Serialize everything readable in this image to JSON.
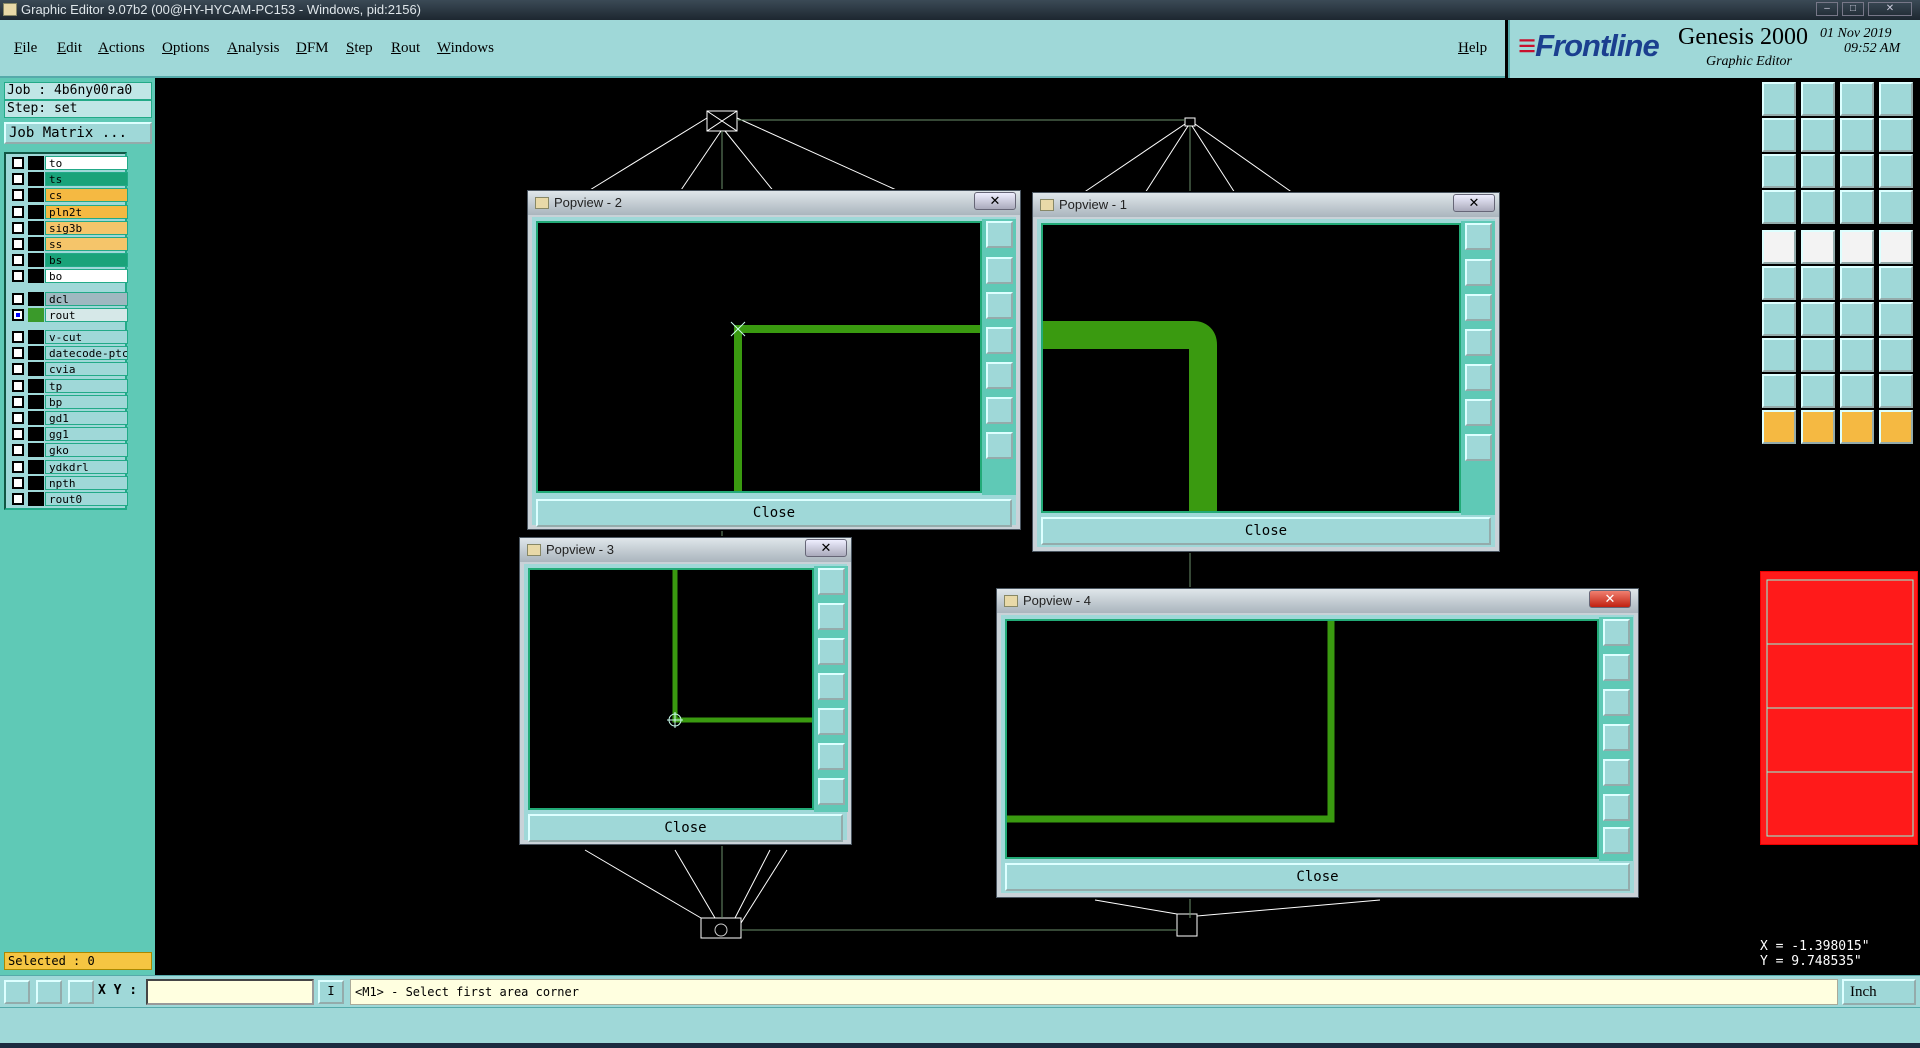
{
  "window": {
    "title": "Graphic Editor 9.07b2 (00@HY-HYCAM-PC153 - Windows, pid:2156)",
    "controls": [
      "–",
      "□",
      "✕"
    ]
  },
  "menu": {
    "items": [
      "File",
      "Edit",
      "Actions",
      "Options",
      "Analysis",
      "DFM",
      "Step",
      "Rout",
      "Windows"
    ],
    "help": "Help"
  },
  "brand": {
    "logo": "Frontline",
    "product": "Genesis 2000",
    "subtitle": "Graphic Editor",
    "date": "01 Nov 2019",
    "time": "09:52 AM"
  },
  "job": {
    "job_line": "Job : 4b6ny00ra0",
    "step_line": "Step: set",
    "matrix_button": "Job Matrix ..."
  },
  "layers": [
    {
      "name": "to",
      "color": "#ffffff",
      "group": 1
    },
    {
      "name": "ts",
      "color": "#1aa37a",
      "group": 1
    },
    {
      "name": "cs",
      "color": "#f5b942",
      "group": 1
    },
    {
      "name": "pln2t",
      "color": "#f5b942",
      "group": 1
    },
    {
      "name": "sig3b",
      "color": "#f5c56a",
      "group": 1
    },
    {
      "name": "ss",
      "color": "#f5c56a",
      "group": 1
    },
    {
      "name": "bs",
      "color": "#1aa37a",
      "group": 1
    },
    {
      "name": "bo",
      "color": "#ffffff",
      "group": 1
    },
    {
      "name": "dcl",
      "color": "#9fb8c0",
      "group": 2
    },
    {
      "name": "rout",
      "color": "#d6e8e8",
      "group": 2,
      "active": true
    },
    {
      "name": "v-cut",
      "color": "#9fd8d8",
      "group": 3
    },
    {
      "name": "datecode-ptc",
      "color": "#9fd8d8",
      "group": 3
    },
    {
      "name": "cvia",
      "color": "#9fd8d8",
      "group": 3
    },
    {
      "name": "tp",
      "color": "#9fd8d8",
      "group": 3
    },
    {
      "name": "bp",
      "color": "#9fd8d8",
      "group": 3
    },
    {
      "name": "gd1",
      "color": "#9fd8d8",
      "group": 3
    },
    {
      "name": "gg1",
      "color": "#9fd8d8",
      "group": 3
    },
    {
      "name": "gko",
      "color": "#9fd8d8",
      "group": 3
    },
    {
      "name": "ydkdrl",
      "color": "#9fd8d8",
      "group": 3
    },
    {
      "name": "npth",
      "color": "#9fd8d8",
      "group": 3
    },
    {
      "name": "rout0",
      "color": "#9fd8d8",
      "group": 3
    }
  ],
  "selected": "Selected : 0",
  "popviews": [
    {
      "title": "Popview - 2",
      "close": "Close",
      "x_mark": "✕"
    },
    {
      "title": "Popview - 1",
      "close": "Close",
      "x_mark": "✕"
    },
    {
      "title": "Popview - 3",
      "close": "Close",
      "x_mark": "✕"
    },
    {
      "title": "Popview - 4",
      "close": "Close",
      "x_mark": "✕"
    }
  ],
  "coords": {
    "x": "X = -1.398015\"",
    "y": "Y = 9.748535\""
  },
  "status": {
    "xy_label": "X Y :",
    "xy_value": "",
    "info_button": "I",
    "message": "<M1> - Select first area corner",
    "units": "Inch"
  },
  "colors": {
    "panel": "#9fd8d8",
    "panel_dark": "#5fc9b6",
    "trace": "#3a9a10",
    "highlight": "#ff1a1a"
  }
}
